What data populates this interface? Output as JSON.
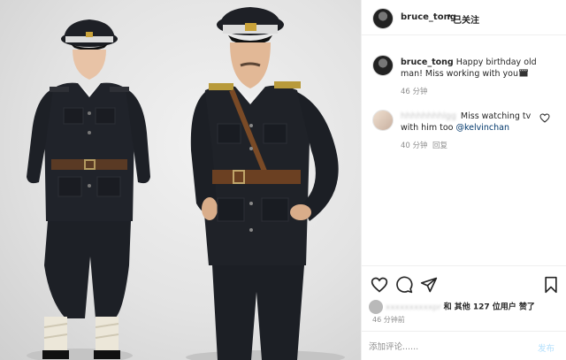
{
  "header": {
    "username": "bruce_tong",
    "dot": "•",
    "follow_status": "已关注"
  },
  "caption": {
    "username": "bruce_tong",
    "text": "Happy birthday old man! Miss working with you",
    "emoji_icon": "clapperboard-icon",
    "time": "46 分钟"
  },
  "comment": {
    "username": "hhhhhhhhlgg",
    "text": "Miss watching tv with him too",
    "mention": "@kelvinchan",
    "time": "40 分钟",
    "reply_label": "回复",
    "like_icon": "heart-outline-icon"
  },
  "actions": {
    "like_icon": "heart-outline-icon",
    "comment_icon": "comment-bubble-icon",
    "share_icon": "paper-plane-icon",
    "save_icon": "bookmark-icon"
  },
  "likes": {
    "username": "xxxxxxxxxxpr",
    "text": "和 其他 127 位用户 赞了"
  },
  "post_time": "46 分钟前",
  "add_comment": {
    "placeholder": "添加评论......",
    "post_label": "发布"
  },
  "colors": {
    "link": "#00376b",
    "muted": "#8e8e8e",
    "post_disabled": "#b2dffc"
  }
}
